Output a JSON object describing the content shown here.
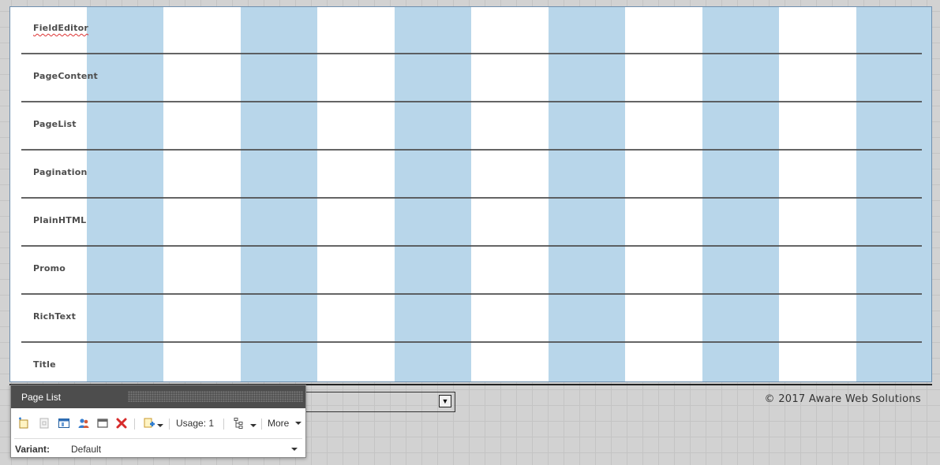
{
  "canvas": {
    "colors": {
      "column": "#b8d6ea",
      "line": "#4a4a4a"
    },
    "rows": [
      {
        "label": "FieldEditor"
      },
      {
        "label": "PageContent"
      },
      {
        "label": "PageList"
      },
      {
        "label": "Pagination"
      },
      {
        "label": "PlainHTML"
      },
      {
        "label": "Promo"
      },
      {
        "label": "RichText"
      },
      {
        "label": "Title"
      }
    ]
  },
  "footer": {
    "copyright": "© 2017 Aware Web Solutions",
    "select_arrow": "▼"
  },
  "panel": {
    "title": "Page List",
    "toolbar": {
      "icons": [
        "insert-icon",
        "duplicate-icon",
        "layout-icon",
        "users-icon",
        "window-icon",
        "delete-icon",
        "add-icon",
        "tree-icon"
      ],
      "usage_label": "Usage: 1",
      "more_label": "More"
    },
    "variant": {
      "label": "Variant:",
      "value": "Default"
    }
  }
}
